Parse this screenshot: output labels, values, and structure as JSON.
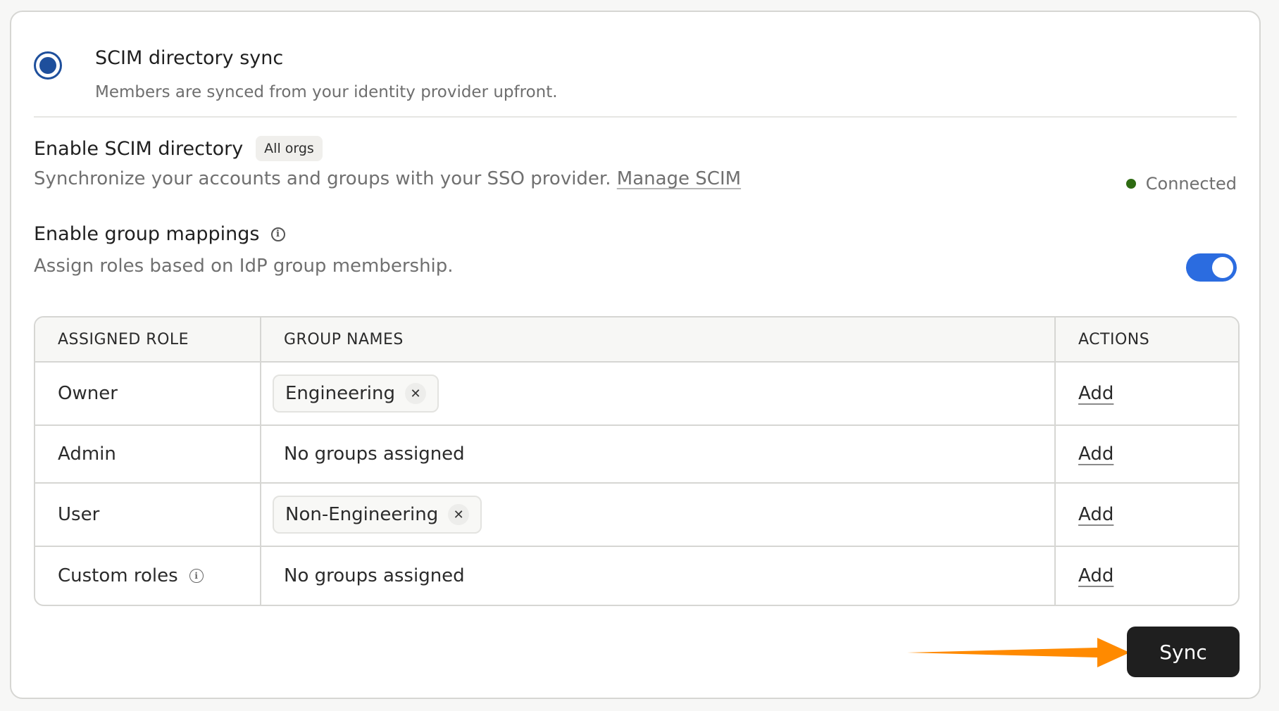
{
  "option": {
    "title": "SCIM directory sync",
    "description": "Members are synced from your identity provider upfront.",
    "selected": true
  },
  "scim": {
    "title": "Enable SCIM directory",
    "badge": "All orgs",
    "description": "Synchronize your accounts and groups with your SSO provider.",
    "manage_link": "Manage SCIM",
    "status": "Connected",
    "status_color": "#2e6b12"
  },
  "group_mappings": {
    "title": "Enable group mappings",
    "description": "Assign roles based on IdP group membership.",
    "enabled": true,
    "toggle_color": "#2b6ce0"
  },
  "table": {
    "headers": [
      "ASSIGNED ROLE",
      "GROUP NAMES",
      "ACTIONS"
    ],
    "rows": [
      {
        "role": "Owner",
        "groups": [
          "Engineering"
        ],
        "empty_text": "",
        "action": "Add"
      },
      {
        "role": "Admin",
        "groups": [],
        "empty_text": "No groups assigned",
        "action": "Add"
      },
      {
        "role": "User",
        "groups": [
          "Non-Engineering"
        ],
        "empty_text": "",
        "action": "Add"
      },
      {
        "role": "Custom roles",
        "groups": [],
        "empty_text": "No groups assigned",
        "action": "Add"
      }
    ]
  },
  "sync_button": "Sync",
  "accent_arrow_color": "#ff8a00"
}
